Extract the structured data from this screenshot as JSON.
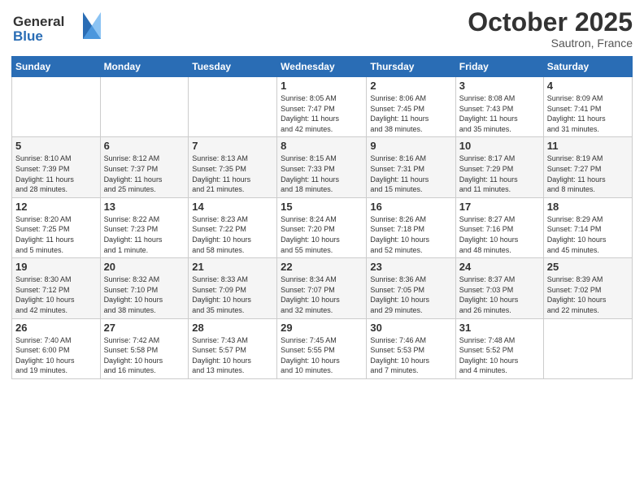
{
  "header": {
    "logo_line1": "General",
    "logo_line2": "Blue",
    "month_title": "October 2025",
    "location": "Sautron, France"
  },
  "weekdays": [
    "Sunday",
    "Monday",
    "Tuesday",
    "Wednesday",
    "Thursday",
    "Friday",
    "Saturday"
  ],
  "weeks": [
    [
      {
        "day": "",
        "info": ""
      },
      {
        "day": "",
        "info": ""
      },
      {
        "day": "",
        "info": ""
      },
      {
        "day": "1",
        "info": "Sunrise: 8:05 AM\nSunset: 7:47 PM\nDaylight: 11 hours\nand 42 minutes."
      },
      {
        "day": "2",
        "info": "Sunrise: 8:06 AM\nSunset: 7:45 PM\nDaylight: 11 hours\nand 38 minutes."
      },
      {
        "day": "3",
        "info": "Sunrise: 8:08 AM\nSunset: 7:43 PM\nDaylight: 11 hours\nand 35 minutes."
      },
      {
        "day": "4",
        "info": "Sunrise: 8:09 AM\nSunset: 7:41 PM\nDaylight: 11 hours\nand 31 minutes."
      }
    ],
    [
      {
        "day": "5",
        "info": "Sunrise: 8:10 AM\nSunset: 7:39 PM\nDaylight: 11 hours\nand 28 minutes."
      },
      {
        "day": "6",
        "info": "Sunrise: 8:12 AM\nSunset: 7:37 PM\nDaylight: 11 hours\nand 25 minutes."
      },
      {
        "day": "7",
        "info": "Sunrise: 8:13 AM\nSunset: 7:35 PM\nDaylight: 11 hours\nand 21 minutes."
      },
      {
        "day": "8",
        "info": "Sunrise: 8:15 AM\nSunset: 7:33 PM\nDaylight: 11 hours\nand 18 minutes."
      },
      {
        "day": "9",
        "info": "Sunrise: 8:16 AM\nSunset: 7:31 PM\nDaylight: 11 hours\nand 15 minutes."
      },
      {
        "day": "10",
        "info": "Sunrise: 8:17 AM\nSunset: 7:29 PM\nDaylight: 11 hours\nand 11 minutes."
      },
      {
        "day": "11",
        "info": "Sunrise: 8:19 AM\nSunset: 7:27 PM\nDaylight: 11 hours\nand 8 minutes."
      }
    ],
    [
      {
        "day": "12",
        "info": "Sunrise: 8:20 AM\nSunset: 7:25 PM\nDaylight: 11 hours\nand 5 minutes."
      },
      {
        "day": "13",
        "info": "Sunrise: 8:22 AM\nSunset: 7:23 PM\nDaylight: 11 hours\nand 1 minute."
      },
      {
        "day": "14",
        "info": "Sunrise: 8:23 AM\nSunset: 7:22 PM\nDaylight: 10 hours\nand 58 minutes."
      },
      {
        "day": "15",
        "info": "Sunrise: 8:24 AM\nSunset: 7:20 PM\nDaylight: 10 hours\nand 55 minutes."
      },
      {
        "day": "16",
        "info": "Sunrise: 8:26 AM\nSunset: 7:18 PM\nDaylight: 10 hours\nand 52 minutes."
      },
      {
        "day": "17",
        "info": "Sunrise: 8:27 AM\nSunset: 7:16 PM\nDaylight: 10 hours\nand 48 minutes."
      },
      {
        "day": "18",
        "info": "Sunrise: 8:29 AM\nSunset: 7:14 PM\nDaylight: 10 hours\nand 45 minutes."
      }
    ],
    [
      {
        "day": "19",
        "info": "Sunrise: 8:30 AM\nSunset: 7:12 PM\nDaylight: 10 hours\nand 42 minutes."
      },
      {
        "day": "20",
        "info": "Sunrise: 8:32 AM\nSunset: 7:10 PM\nDaylight: 10 hours\nand 38 minutes."
      },
      {
        "day": "21",
        "info": "Sunrise: 8:33 AM\nSunset: 7:09 PM\nDaylight: 10 hours\nand 35 minutes."
      },
      {
        "day": "22",
        "info": "Sunrise: 8:34 AM\nSunset: 7:07 PM\nDaylight: 10 hours\nand 32 minutes."
      },
      {
        "day": "23",
        "info": "Sunrise: 8:36 AM\nSunset: 7:05 PM\nDaylight: 10 hours\nand 29 minutes."
      },
      {
        "day": "24",
        "info": "Sunrise: 8:37 AM\nSunset: 7:03 PM\nDaylight: 10 hours\nand 26 minutes."
      },
      {
        "day": "25",
        "info": "Sunrise: 8:39 AM\nSunset: 7:02 PM\nDaylight: 10 hours\nand 22 minutes."
      }
    ],
    [
      {
        "day": "26",
        "info": "Sunrise: 7:40 AM\nSunset: 6:00 PM\nDaylight: 10 hours\nand 19 minutes."
      },
      {
        "day": "27",
        "info": "Sunrise: 7:42 AM\nSunset: 5:58 PM\nDaylight: 10 hours\nand 16 minutes."
      },
      {
        "day": "28",
        "info": "Sunrise: 7:43 AM\nSunset: 5:57 PM\nDaylight: 10 hours\nand 13 minutes."
      },
      {
        "day": "29",
        "info": "Sunrise: 7:45 AM\nSunset: 5:55 PM\nDaylight: 10 hours\nand 10 minutes."
      },
      {
        "day": "30",
        "info": "Sunrise: 7:46 AM\nSunset: 5:53 PM\nDaylight: 10 hours\nand 7 minutes."
      },
      {
        "day": "31",
        "info": "Sunrise: 7:48 AM\nSunset: 5:52 PM\nDaylight: 10 hours\nand 4 minutes."
      },
      {
        "day": "",
        "info": ""
      }
    ]
  ]
}
